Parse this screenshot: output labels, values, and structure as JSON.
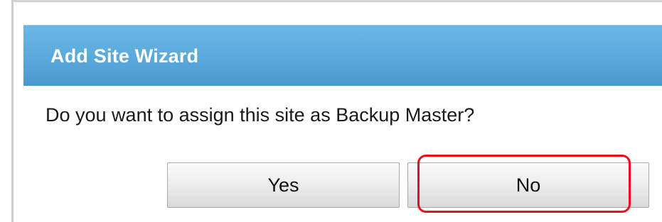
{
  "dialog": {
    "title": "Add Site Wizard",
    "message": "Do you want to assign this site as Backup Master?",
    "buttons": {
      "yes_label": "Yes",
      "no_label": "No"
    }
  },
  "colors": {
    "title_bar": "#5aa9dc",
    "title_text": "#ffffff",
    "highlight": "#e8111a"
  }
}
